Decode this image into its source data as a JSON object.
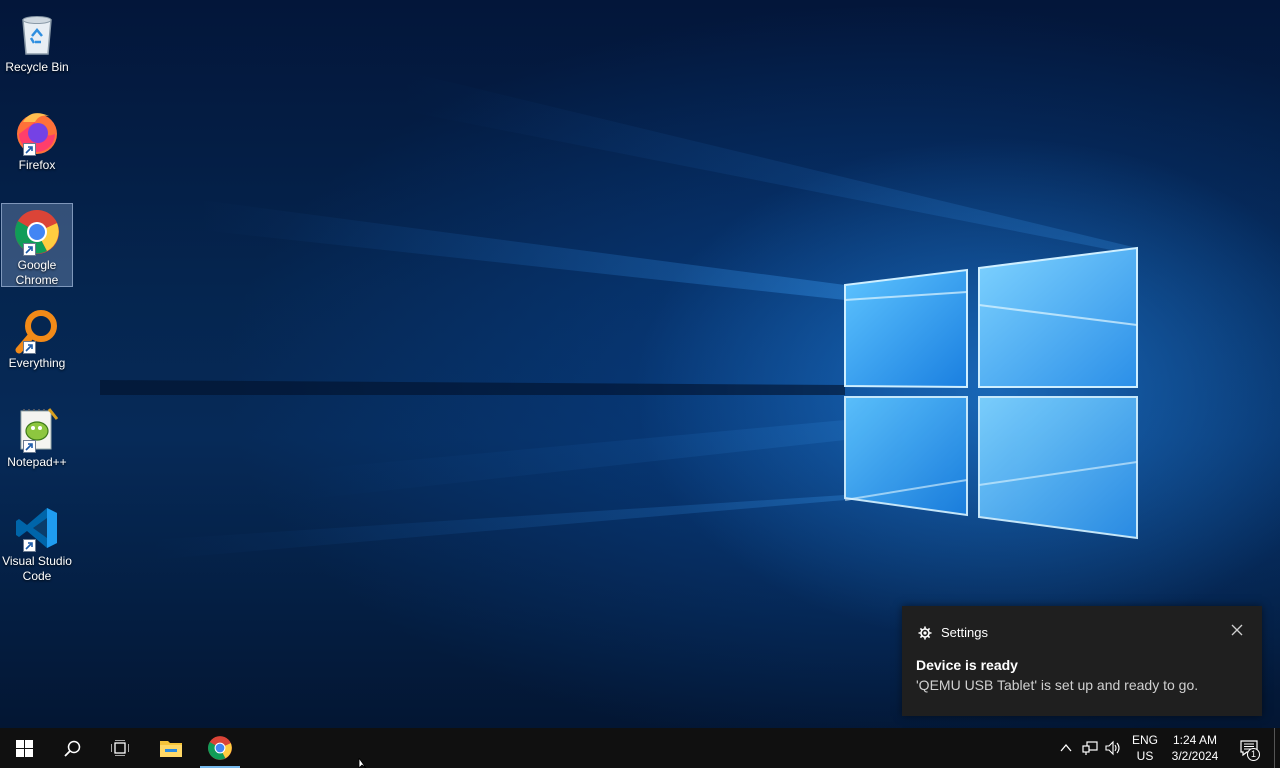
{
  "desktop": {
    "icons": [
      {
        "label": "Recycle Bin",
        "icon": "recycle-bin-icon"
      },
      {
        "label": "Firefox",
        "icon": "firefox-icon"
      },
      {
        "label": "Google Chrome",
        "icon": "chrome-icon",
        "selected": true
      },
      {
        "label": "Everything",
        "icon": "everything-search-icon"
      },
      {
        "label": "Notepad++",
        "icon": "notepad-plus-plus-icon"
      },
      {
        "label": "Visual Studio Code",
        "icon": "vscode-icon"
      }
    ]
  },
  "toast": {
    "app_name": "Settings",
    "title": "Device is ready",
    "body": "'QEMU USB Tablet' is set up and ready to go."
  },
  "taskbar": {
    "language_line1": "ENG",
    "language_line2": "US",
    "time": "1:24 AM",
    "date": "3/2/2024",
    "notification_count": "1"
  },
  "colors": {
    "accent": "#76b9ed",
    "taskbar": "#101010",
    "toast_bg": "#1f1f1f"
  }
}
